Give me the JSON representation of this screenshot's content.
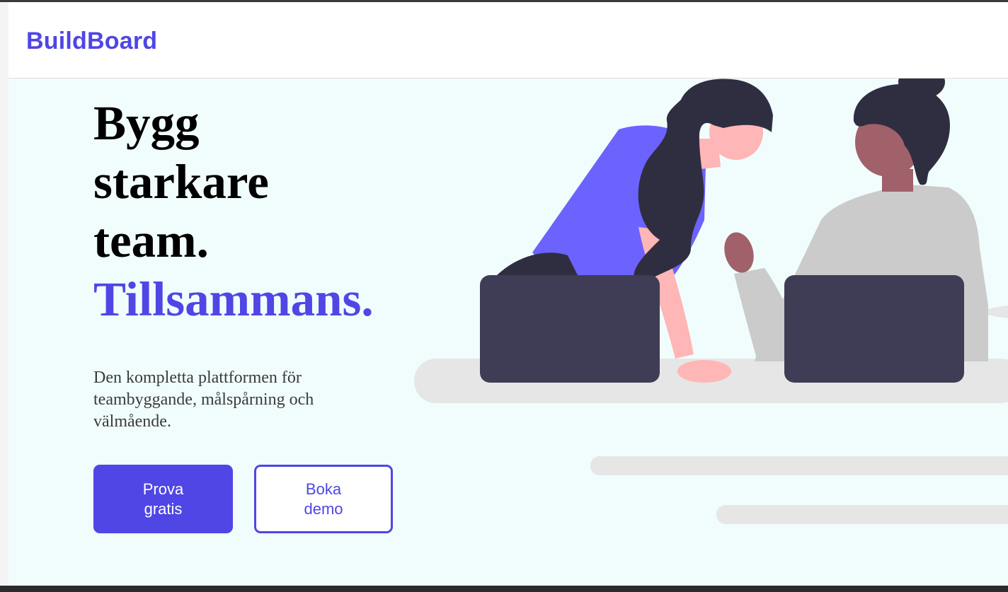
{
  "header": {
    "logo": "BuildBoard"
  },
  "hero": {
    "title_lines": [
      "Bygg",
      "starkare",
      "team."
    ],
    "title_accent": "Tillsammans.",
    "subtitle": "Den kompletta plattformen för teambyggande, målspårning och välmående.",
    "primary_button": "Prova gratis",
    "secondary_button": "Boka demo"
  },
  "colors": {
    "brand": "#4f46e5",
    "hero_background": "#f1fdfd",
    "laptop": "#3f3d56",
    "shirt_purple": "#6c63ff",
    "hair": "#2f2e41",
    "skin_light": "#ffb6b6",
    "skin_dark": "#a0616a",
    "shirt_grey": "#cbcbcb",
    "desk": "#e6e6e6"
  },
  "illustration": {
    "icon": "team-collaboration-illustration"
  }
}
